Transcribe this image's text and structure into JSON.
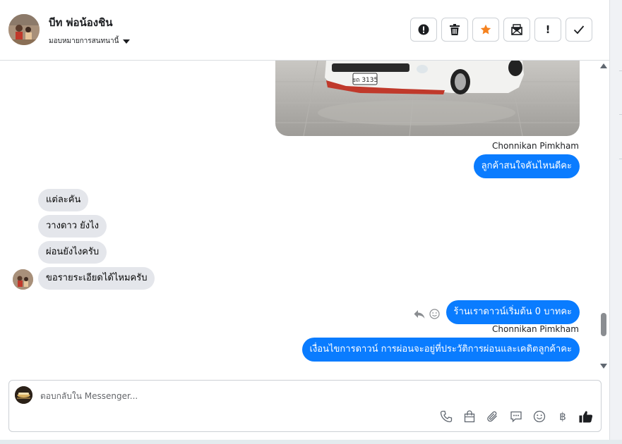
{
  "header": {
    "title": "บีท พ่อน้องชิน",
    "assign_label": "มอบหมายการสนทนานี้"
  },
  "toolbar": {
    "buttons": [
      {
        "name": "spam",
        "icon": "exclamation-circle-icon"
      },
      {
        "name": "delete",
        "icon": "trash-icon"
      },
      {
        "name": "star",
        "icon": "star-icon",
        "color": "#f5821f"
      },
      {
        "name": "mark-unread",
        "icon": "envelope-icon"
      },
      {
        "name": "important",
        "icon": "exclamation-icon",
        "label": "!"
      },
      {
        "name": "done",
        "icon": "check-icon"
      }
    ]
  },
  "messages": {
    "sender_name_1": "Chonnikan Pimkham",
    "out_1": "ลูกค้าสนใจคันไหนดีคะ",
    "in_1": "แต่ละคัน",
    "in_2": "วางดาว ยังไง",
    "in_3": "ผ่อนยังไงครับ",
    "in_4": "ขอรายระเอียดได้ไหมครับ",
    "out_2": "ร้านเราดาวน์เริ่มต้น 0 บาทคะ",
    "sender_name_2": "Chonnikan Pimkham",
    "out_3": "เงื่อนไขการดาวน์ การผ่อนจะอยู่ที่ประวัติการผ่อนและเคดิตลูกค้าคะ",
    "car_plate": "ยถ 3135"
  },
  "composer": {
    "placeholder": "ตอบกลับใน Messenger...",
    "icons": [
      "phone-icon",
      "shopping-bag-icon",
      "paperclip-icon",
      "message-icon",
      "emoji-icon",
      "baht-icon",
      "thumbs-up-icon"
    ],
    "baht_symbol": "฿"
  },
  "colors": {
    "outgoing_bubble": "#0a7cff",
    "incoming_bubble": "#e4e6eb",
    "star": "#f5821f"
  }
}
